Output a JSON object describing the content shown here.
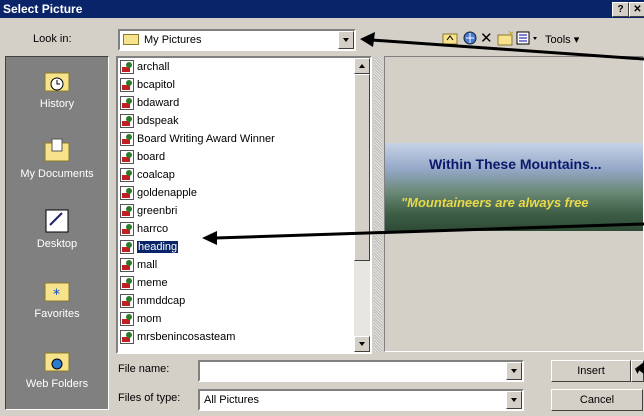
{
  "window": {
    "title": "Select Picture",
    "help_label": "?",
    "close_label": "✕"
  },
  "look_in": {
    "label": "Look in:",
    "value": "My Pictures"
  },
  "toolbar": {
    "tools_label": "Tools"
  },
  "places": [
    {
      "label": "History",
      "icon": "history-icon"
    },
    {
      "label": "My Documents",
      "icon": "my-documents-icon"
    },
    {
      "label": "Desktop",
      "icon": "desktop-icon"
    },
    {
      "label": "Favorites",
      "icon": "favorites-icon"
    },
    {
      "label": "Web Folders",
      "icon": "web-folders-icon"
    }
  ],
  "files": [
    "archall",
    "bcapitol",
    "bdaward",
    "bdspeak",
    "Board Writing Award Winner",
    "board",
    "coalcap",
    "goldenapple",
    "greenbri",
    "harrco",
    "heading",
    "mall",
    "meme",
    "mmddcap",
    "mom",
    "mrsbenincosasteam"
  ],
  "selected_file": "heading",
  "preview": {
    "headline": "Within These Mountains...",
    "subtitle": "\"Mountaineers are always free"
  },
  "file_name": {
    "label": "File name:",
    "value": ""
  },
  "files_of_type": {
    "label": "Files of type:",
    "value": "All Pictures"
  },
  "buttons": {
    "insert": "Insert",
    "cancel": "Cancel"
  }
}
